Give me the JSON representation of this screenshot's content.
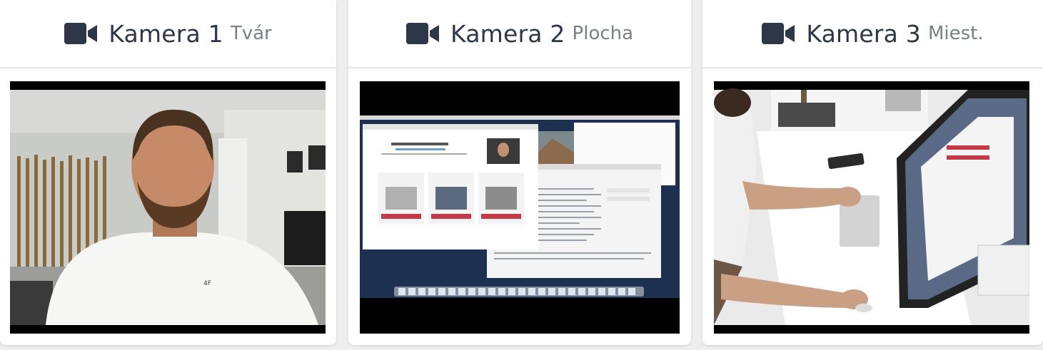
{
  "cameras": [
    {
      "title": "Kamera 1",
      "subtitle": "Tvár",
      "icon": "video-camera-icon"
    },
    {
      "title": "Kamera 2",
      "subtitle": "Plocha",
      "icon": "video-camera-icon"
    },
    {
      "title": "Kamera 3",
      "subtitle": "Miest.",
      "icon": "video-camera-icon"
    }
  ],
  "colors": {
    "title": "#2d3748",
    "subtitle": "#7a8087",
    "icon": "#2d3748",
    "background": "#eeeeee"
  }
}
